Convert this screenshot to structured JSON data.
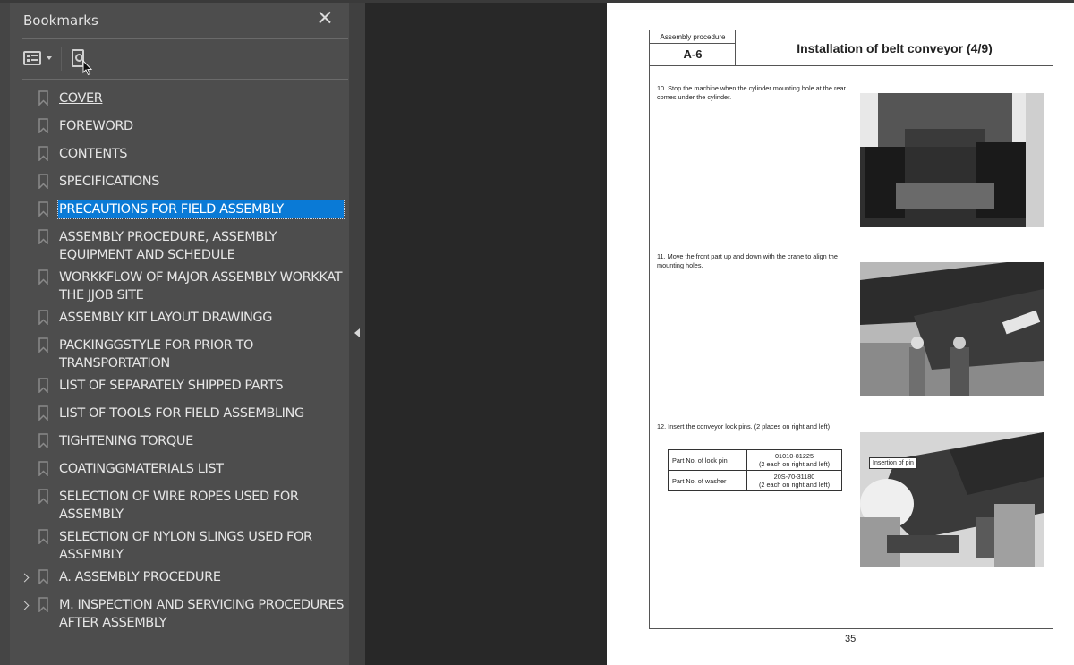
{
  "bookmarks_panel": {
    "title": "Bookmarks",
    "close_icon": "close-icon",
    "options_icon": "list-options-icon",
    "find_icon": "find-current-bookmark-icon",
    "items": [
      {
        "label": "COVER",
        "expandable": false,
        "selected": false
      },
      {
        "label": "FOREWORD",
        "expandable": false,
        "selected": false
      },
      {
        "label": "CONTENTS",
        "expandable": false,
        "selected": false
      },
      {
        "label": "SPECIFICATIONS",
        "expandable": false,
        "selected": false
      },
      {
        "label": "PRECAUTIONS FOR FIELD ASSEMBLY",
        "expandable": false,
        "selected": true
      },
      {
        "label": "ASSEMBLY PROCEDURE, ASSEMBLY EQUIPMENT AND SCHEDULE",
        "expandable": false,
        "selected": false
      },
      {
        "label": "WORKKFLOW OF MAJOR ASSEMBLY WORKKAT THE JJOB SITE",
        "expandable": false,
        "selected": false
      },
      {
        "label": "ASSEMBLY KIT LAYOUT DRAWINGG",
        "expandable": false,
        "selected": false
      },
      {
        "label": "PACKINGGSTYLE FOR PRIOR TO TRANSPORTATION",
        "expandable": false,
        "selected": false
      },
      {
        "label": "LIST OF SEPARATELY SHIPPED PARTS",
        "expandable": false,
        "selected": false
      },
      {
        "label": "LIST OF TOOLS FOR FIELD ASSEMBLING",
        "expandable": false,
        "selected": false
      },
      {
        "label": "TIGHTENING TORQUE",
        "expandable": false,
        "selected": false
      },
      {
        "label": "COATINGGMATERIALS LIST",
        "expandable": false,
        "selected": false
      },
      {
        "label": "SELECTION OF WIRE ROPES USED FOR ASSEMBLY",
        "expandable": false,
        "selected": false
      },
      {
        "label": "SELECTION OF NYLON SLINGS USED FOR ASSEMBLY",
        "expandable": false,
        "selected": false
      },
      {
        "label": "A. ASSEMBLY PROCEDURE",
        "expandable": true,
        "selected": false
      },
      {
        "label": "M. INSPECTION AND SERVICING PROCEDURES AFTER ASSEMBLY",
        "expandable": true,
        "selected": false
      }
    ]
  },
  "document": {
    "header": {
      "section_label": "Assembly procedure",
      "section_code": "A-6",
      "title": "Installation of belt conveyor (4/9)"
    },
    "steps": [
      {
        "text": "10. Stop the machine when the cylinder mounting hole at the rear comes under the cylinder."
      },
      {
        "text": "11. Move the front part up and down with the crane to align the mounting holes."
      },
      {
        "text": "12. Insert the conveyor lock pins. (2 places on right and left)"
      }
    ],
    "parts_table": [
      {
        "name": "Part No. of lock pin",
        "number": "01010-81225",
        "note": "(2 each on right and left)"
      },
      {
        "name": "Part No. of washer",
        "number": "20S-70-31180",
        "note": "(2 each on right and left)"
      }
    ],
    "photo_callout": "Insertion of pin",
    "page_number": "35"
  },
  "colors": {
    "selection": "#0a7ad6",
    "panel_bg": "#4d4d4d",
    "viewer_bg": "#282828"
  }
}
